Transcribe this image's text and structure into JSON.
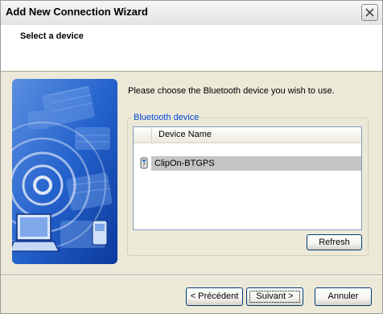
{
  "window": {
    "title": "Add New Connection Wizard",
    "close_icon": "close-icon"
  },
  "header": {
    "title": "Select a device"
  },
  "illustration": {
    "icon": "bluetooth-wireless-illustration"
  },
  "main": {
    "instruction": "Please choose the Bluetooth device you wish to use.",
    "group_label": "Bluetooth device",
    "list": {
      "columns": [
        "",
        "Device Name"
      ],
      "rows": [
        {
          "icon": "bluetooth-device-icon",
          "name": "ClipOn-BTGPS",
          "selected": true
        }
      ]
    },
    "refresh_label": "Refresh"
  },
  "footer": {
    "back_label": "< Précédent",
    "next_label": "Suivant >",
    "cancel_label": "Annuler"
  },
  "colors": {
    "accent": "#0046d5",
    "selection": "#c4c4c4",
    "illustration_blue": "#1d5fc8"
  }
}
